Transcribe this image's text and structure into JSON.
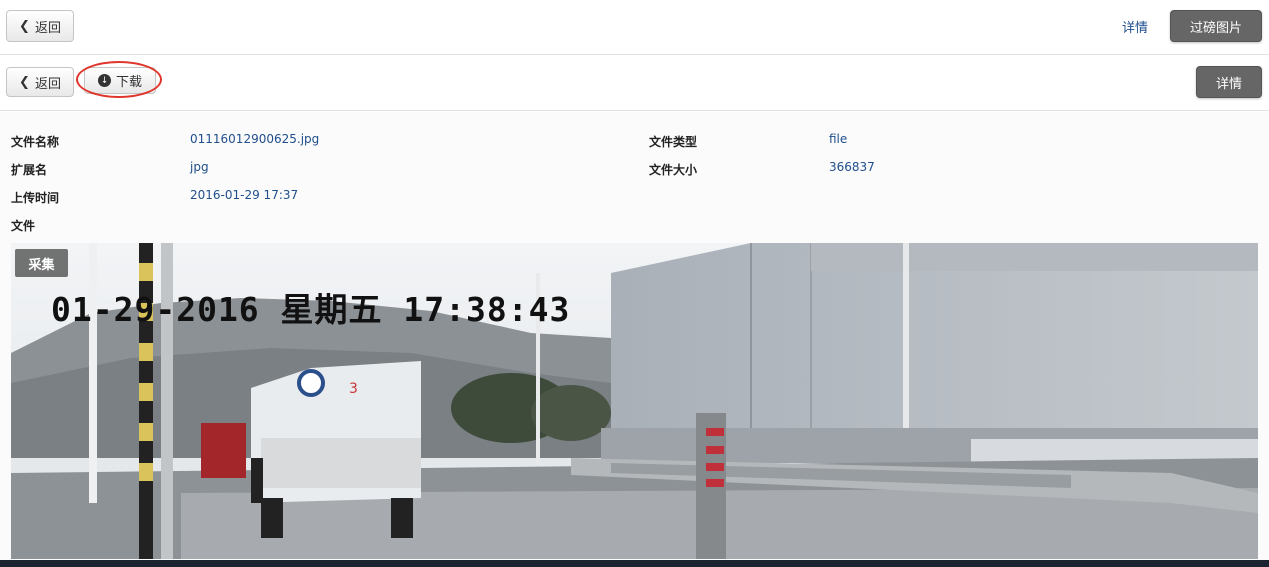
{
  "topbar": {
    "back_label": "返回",
    "details_link": "详情",
    "weigh_images_label": "过磅图片"
  },
  "toolbar": {
    "back_label": "返回",
    "download_label": "下载",
    "details_label": "详情"
  },
  "file_info": {
    "name_label": "文件名称",
    "name_value": "01116012900625.jpg",
    "type_label": "文件类型",
    "type_value": "file",
    "ext_label": "扩展名",
    "ext_value": "jpg",
    "size_label": "文件大小",
    "size_value": "366837",
    "upload_label": "上传时间",
    "upload_value": "2016-01-29 17:37",
    "file_label": "文件"
  },
  "photo": {
    "tag": "采集",
    "timestamp": "01-29-2016 星期五 17:38:43",
    "truck_number": "3"
  },
  "colors": {
    "link": "#1f4e8c",
    "dark_button": "#666666",
    "annotation": "#e0352b"
  }
}
